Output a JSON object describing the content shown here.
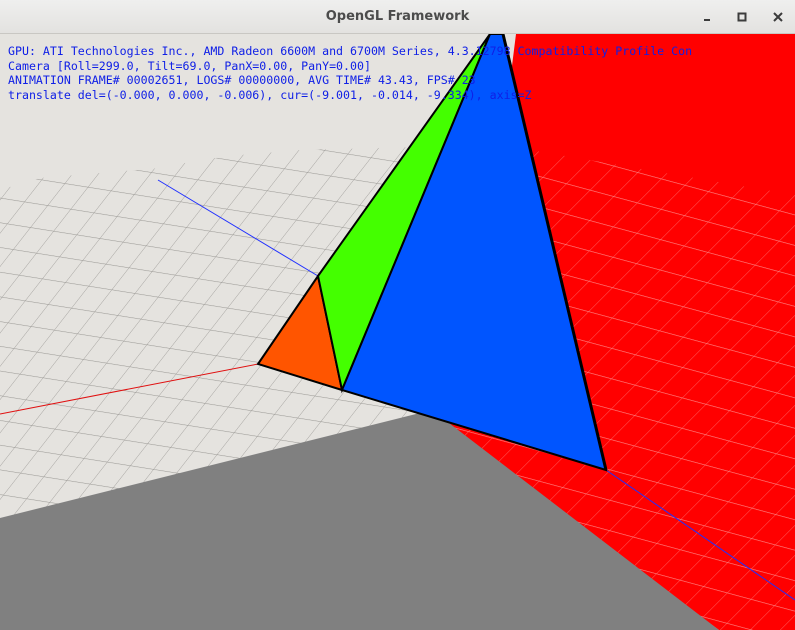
{
  "window": {
    "title": "OpenGL Framework",
    "controls": {
      "minimize_icon": "minimize-icon",
      "maximize_icon": "maximize-icon",
      "close_icon": "close-icon"
    }
  },
  "hud": {
    "lines": [
      "GPU: ATI Technologies Inc., AMD Radeon 6600M and 6700M Series, 4.3.12798 Compatibility Profile Con",
      "Camera [Roll=299.0, Tilt=69.0, PanX=0.00, PanY=0.00]",
      "ANIMATION FRAME# 00002651, LOGS# 00000000, AVG TIME# 43.43, FPS# 23",
      "translate del=(-0.000, 0.000, -0.006), cur=(-9.001, -0.014, -9.334), axis=Z"
    ]
  },
  "colors": {
    "background": "#e5e3df",
    "text": "#1020e6",
    "red_plane": "#ff0000",
    "gray_plane": "#808080",
    "face_blue": "#0055ff",
    "face_green": "#44ff00",
    "face_orange": "#ff5500",
    "x_axis": "#e01010",
    "z_axis": "#2030ff"
  }
}
